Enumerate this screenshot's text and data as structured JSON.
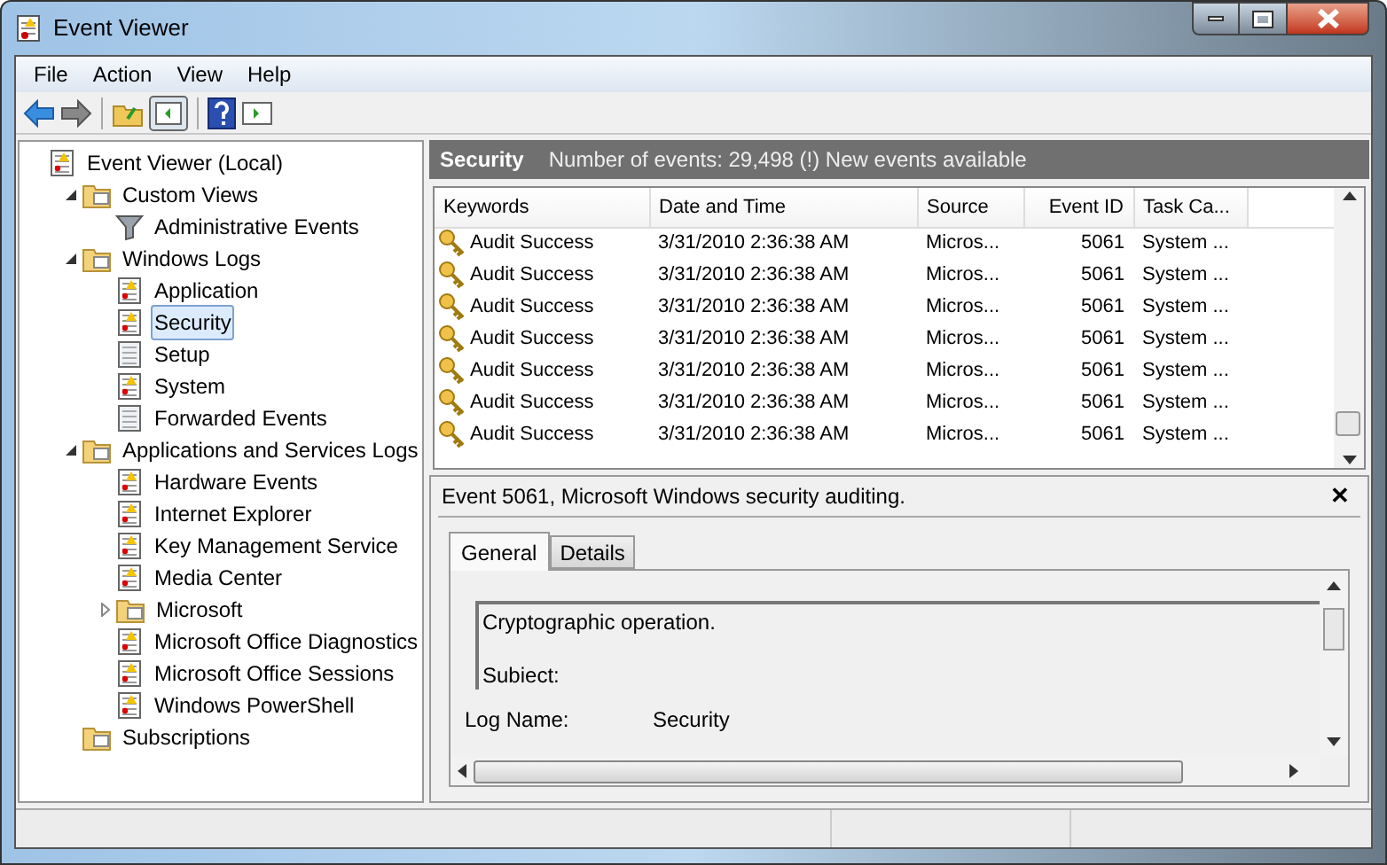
{
  "window": {
    "title": "Event Viewer"
  },
  "menu": [
    "File",
    "Action",
    "View",
    "Help"
  ],
  "tree": [
    {
      "label": "Event Viewer (Local)",
      "kind": "log",
      "selected": false,
      "children": [
        {
          "label": "Custom Views",
          "kind": "folder",
          "selected": false,
          "expanded": true,
          "children": [
            {
              "label": "Administrative Events",
              "kind": "filter",
              "selected": false
            }
          ]
        },
        {
          "label": "Windows Logs",
          "kind": "folder",
          "selected": false,
          "expanded": true,
          "children": [
            {
              "label": "Application",
              "kind": "log",
              "selected": false
            },
            {
              "label": "Security",
              "kind": "log",
              "selected": true
            },
            {
              "label": "Setup",
              "kind": "blank",
              "selected": false
            },
            {
              "label": "System",
              "kind": "log",
              "selected": false
            },
            {
              "label": "Forwarded Events",
              "kind": "blank",
              "selected": false
            }
          ]
        },
        {
          "label": "Applications and Services Logs",
          "kind": "folder",
          "selected": false,
          "expanded": true,
          "children": [
            {
              "label": "Hardware Events",
              "kind": "log",
              "selected": false
            },
            {
              "label": "Internet Explorer",
              "kind": "log",
              "selected": false
            },
            {
              "label": "Key Management Service",
              "kind": "log",
              "selected": false
            },
            {
              "label": "Media Center",
              "kind": "log",
              "selected": false
            },
            {
              "label": "Microsoft",
              "kind": "folder",
              "selected": false,
              "expanded": false
            },
            {
              "label": "Microsoft Office Diagnostics",
              "kind": "log",
              "selected": false
            },
            {
              "label": "Microsoft Office Sessions",
              "kind": "log",
              "selected": false
            },
            {
              "label": "Windows PowerShell",
              "kind": "log",
              "selected": false
            }
          ]
        },
        {
          "label": "Subscriptions",
          "kind": "folder",
          "selected": false
        }
      ]
    }
  ],
  "log_header": {
    "title": "Security",
    "summary": "Number of events: 29,498 (!) New events available"
  },
  "table": {
    "columns": [
      "Keywords",
      "Date and Time",
      "Source",
      "Event ID",
      "Task Ca..."
    ],
    "rows": [
      [
        "Audit Success",
        "3/31/2010 2:36:38 AM",
        "Micros...",
        "5061",
        "System ..."
      ],
      [
        "Audit Success",
        "3/31/2010 2:36:38 AM",
        "Micros...",
        "5061",
        "System ..."
      ],
      [
        "Audit Success",
        "3/31/2010 2:36:38 AM",
        "Micros...",
        "5061",
        "System ..."
      ],
      [
        "Audit Success",
        "3/31/2010 2:36:38 AM",
        "Micros...",
        "5061",
        "System ..."
      ],
      [
        "Audit Success",
        "3/31/2010 2:36:38 AM",
        "Micros...",
        "5061",
        "System ..."
      ],
      [
        "Audit Success",
        "3/31/2010 2:36:38 AM",
        "Micros...",
        "5061",
        "System ..."
      ],
      [
        "Audit Success",
        "3/31/2010 2:36:38 AM",
        "Micros...",
        "5061",
        "System ..."
      ]
    ]
  },
  "detail": {
    "title": "Event 5061, Microsoft Windows security auditing.",
    "close": "✕",
    "tabs": [
      {
        "label": "General",
        "selected": true
      },
      {
        "label": "Details",
        "selected": false
      }
    ],
    "description": [
      "Cryptographic operation.",
      "Subiect:"
    ],
    "fields": [
      {
        "label": "Log Name:",
        "value": "Security"
      }
    ]
  }
}
